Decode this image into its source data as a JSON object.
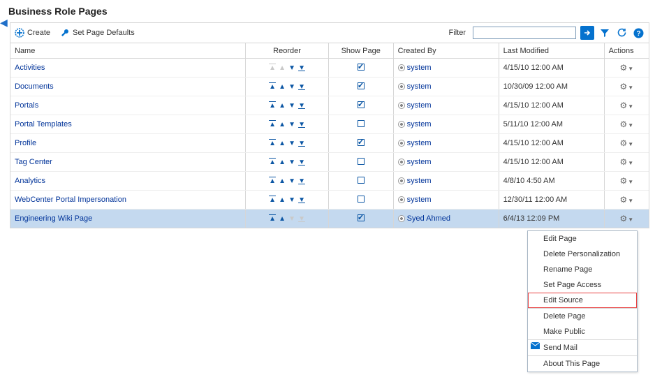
{
  "page_title": "Business Role Pages",
  "toolbar": {
    "create_label": "Create",
    "defaults_label": "Set Page Defaults",
    "filter_label": "Filter"
  },
  "columns": {
    "name": "Name",
    "reorder": "Reorder",
    "show_page": "Show Page",
    "created_by": "Created By",
    "last_modified": "Last Modified",
    "actions": "Actions"
  },
  "rows": [
    {
      "name": "Activities",
      "reorder_first": true,
      "reorder_last": false,
      "show": true,
      "created_by": "system",
      "last_modified": "4/15/10 12:00 AM"
    },
    {
      "name": "Documents",
      "reorder_first": false,
      "reorder_last": false,
      "show": true,
      "created_by": "system",
      "last_modified": "10/30/09 12:00 AM"
    },
    {
      "name": "Portals",
      "reorder_first": false,
      "reorder_last": false,
      "show": true,
      "created_by": "system",
      "last_modified": "4/15/10 12:00 AM"
    },
    {
      "name": "Portal Templates",
      "reorder_first": false,
      "reorder_last": false,
      "show": false,
      "created_by": "system",
      "last_modified": "5/11/10 12:00 AM"
    },
    {
      "name": "Profile",
      "reorder_first": false,
      "reorder_last": false,
      "show": true,
      "created_by": "system",
      "last_modified": "4/15/10 12:00 AM"
    },
    {
      "name": "Tag Center",
      "reorder_first": false,
      "reorder_last": false,
      "show": false,
      "created_by": "system",
      "last_modified": "4/15/10 12:00 AM"
    },
    {
      "name": "Analytics",
      "reorder_first": false,
      "reorder_last": false,
      "show": false,
      "created_by": "system",
      "last_modified": "4/8/10 4:50 AM"
    },
    {
      "name": "WebCenter Portal Impersonation",
      "reorder_first": false,
      "reorder_last": false,
      "show": false,
      "created_by": "system",
      "last_modified": "12/30/11 12:00 AM"
    },
    {
      "name": "Engineering Wiki Page",
      "reorder_first": false,
      "reorder_last": true,
      "show": true,
      "created_by": "Syed Ahmed",
      "last_modified": "6/4/13 12:09 PM",
      "selected": true
    }
  ],
  "menu": {
    "edit_page": "Edit Page",
    "delete_personalization": "Delete Personalization",
    "rename_page": "Rename Page",
    "set_page_access": "Set Page Access",
    "edit_source": "Edit Source",
    "delete_page": "Delete Page",
    "make_public": "Make Public",
    "send_mail": "Send Mail",
    "about_this_page": "About This Page"
  }
}
